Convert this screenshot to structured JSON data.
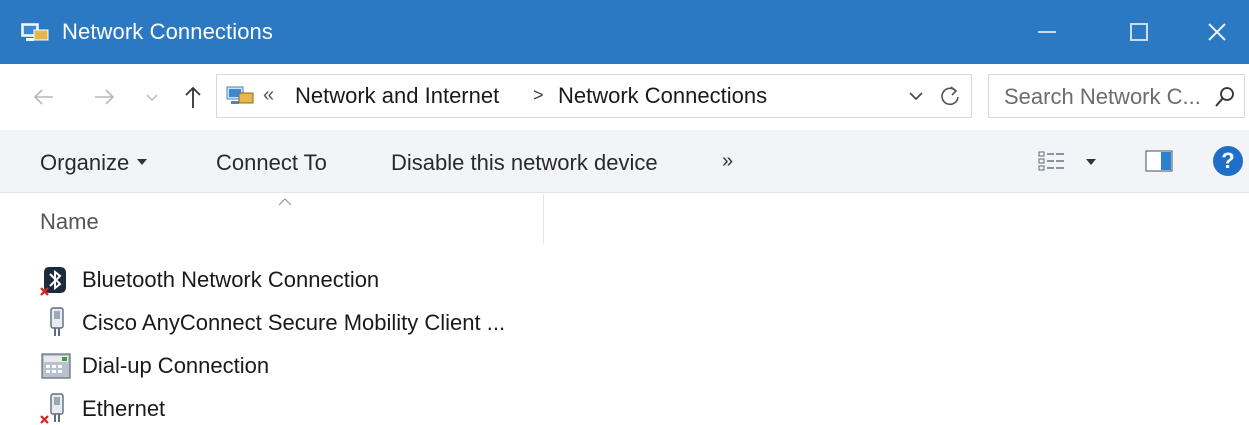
{
  "window": {
    "title": "Network Connections",
    "accent": "#2b79c2",
    "app_icon": "network-connections-icon"
  },
  "address": {
    "overflow": "«",
    "crumbs": [
      "Network and Internet",
      "Network Connections"
    ],
    "separator": ">",
    "search_placeholder": "Search Network C..."
  },
  "commands": {
    "organize": "Organize",
    "connect_to": "Connect To",
    "disable": "Disable this network device",
    "more": "»",
    "help": "?"
  },
  "list": {
    "column_name": "Name",
    "items": [
      {
        "label": "Bluetooth Network Connection",
        "icon": "bluetooth-adapter-icon",
        "disconnected": true
      },
      {
        "label": "Cisco AnyConnect Secure Mobility Client ...",
        "icon": "network-adapter-icon",
        "disconnected": false
      },
      {
        "label": "Dial-up Connection",
        "icon": "dialup-modem-icon",
        "disconnected": false
      },
      {
        "label": "Ethernet",
        "icon": "ethernet-adapter-icon",
        "disconnected": true
      }
    ]
  }
}
